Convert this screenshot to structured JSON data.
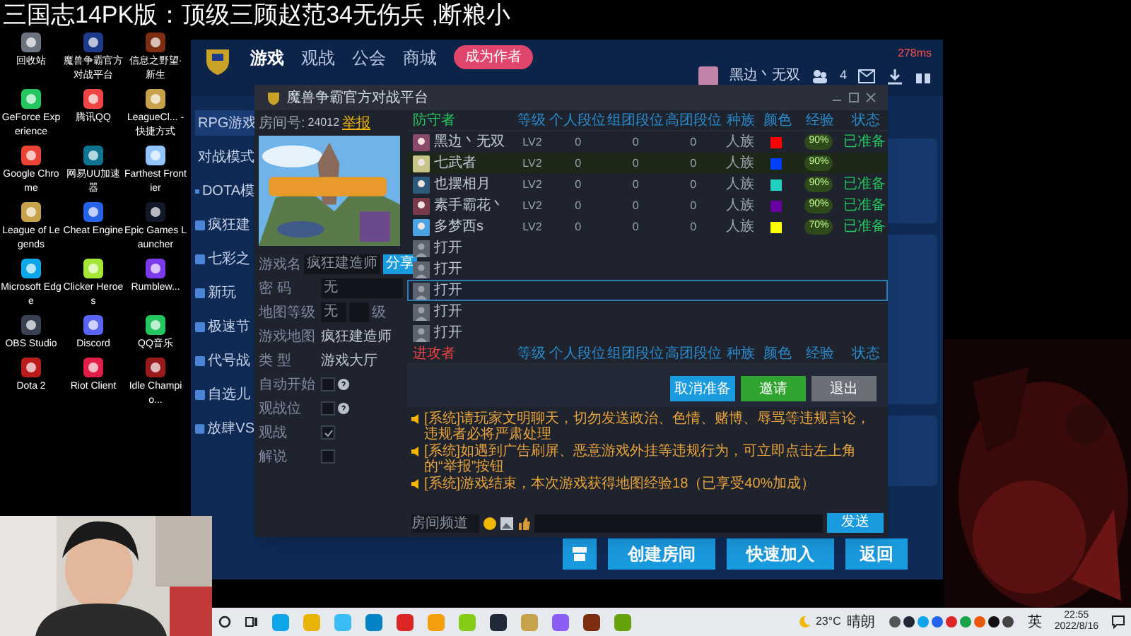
{
  "stream_title": "三国志14PK版：顶级三顾赵范34无伤兵 ,断粮小",
  "desktop_icons": [
    {
      "label": "回收站"
    },
    {
      "label": "魔兽争霸官方对战平台"
    },
    {
      "label": "信息之野望·新生"
    },
    {
      "label": "GeForce Experience"
    },
    {
      "label": "腾讯QQ"
    },
    {
      "label": "LeagueCl... - 快捷方式"
    },
    {
      "label": "Google Chrome"
    },
    {
      "label": "网易UU加速器"
    },
    {
      "label": "Farthest Frontier"
    },
    {
      "label": "League of Legends"
    },
    {
      "label": "Cheat Engine"
    },
    {
      "label": "Epic Games Launcher"
    },
    {
      "label": "Microsoft Edge"
    },
    {
      "label": "Clicker Heroes"
    },
    {
      "label": "Rumblew..."
    },
    {
      "label": "OBS Studio"
    },
    {
      "label": "Discord"
    },
    {
      "label": "QQ音乐"
    },
    {
      "label": "Dota 2"
    },
    {
      "label": "Riot Client"
    },
    {
      "label": "Idle Champio..."
    }
  ],
  "platform": {
    "nav": [
      {
        "label": "游戏",
        "selected": true
      },
      {
        "label": "观战",
        "selected": false
      },
      {
        "label": "公会",
        "selected": false
      },
      {
        "label": "商城",
        "selected": false
      }
    ],
    "author_badge": "成为作者",
    "ping": "278ms",
    "user": "黑边丶无双",
    "notifications": "4",
    "sidebar": [
      {
        "label": "RPG游戏",
        "selected": true
      },
      {
        "label": "对战模式",
        "selected": false
      },
      {
        "label": "DOTA模",
        "selected": false
      },
      {
        "label": "疯狂建",
        "selected": false
      },
      {
        "label": "七彩之",
        "selected": false
      },
      {
        "label": "新玩",
        "selected": false
      },
      {
        "label": "极速节",
        "selected": false
      },
      {
        "label": "代号战",
        "selected": false
      },
      {
        "label": "自选儿",
        "selected": false
      },
      {
        "label": "放肆VS",
        "selected": false
      }
    ],
    "bottom_buttons": [
      "创建房间",
      "快速加入",
      "返回"
    ]
  },
  "dialog": {
    "title": "魔兽争霸官方对战平台",
    "room_label": "房间号:",
    "room_number": "24012",
    "report": "举报",
    "fields": [
      {
        "kind": "input",
        "label": "游戏名",
        "value": "疯狂建造师",
        "button": "分享"
      },
      {
        "kind": "input",
        "label": "密 码",
        "value": "无"
      },
      {
        "kind": "level",
        "label": "地图等级",
        "value": "无",
        "unit": "级"
      },
      {
        "kind": "text",
        "label": "游戏地图",
        "value": "疯狂建造师"
      },
      {
        "kind": "text",
        "label": "类 型",
        "value": "游戏大厅"
      },
      {
        "kind": "check",
        "label": "自动开始",
        "checked": false,
        "help": true
      },
      {
        "kind": "check",
        "label": "观战位",
        "checked": false,
        "help": true
      },
      {
        "kind": "check",
        "label": "观战",
        "checked": true,
        "help": false
      },
      {
        "kind": "check",
        "label": "解说",
        "checked": false,
        "help": false
      }
    ],
    "teams": [
      {
        "label": "防守者",
        "color": "#22c55e",
        "columns": [
          "等级",
          "个人段位",
          "组团段位",
          "高团段位",
          "种族",
          "颜色",
          "经验",
          "状态"
        ],
        "slots": [
          {
            "kind": "player",
            "name": "黑边丶无双",
            "cells": [
              "LV2",
              "0",
              "0",
              "0",
              "人族"
            ],
            "color": "#ff0000",
            "exp": "90%",
            "status": "已准备",
            "is_self": false,
            "selected": false
          },
          {
            "kind": "player",
            "name": "七武者",
            "cells": [
              "LV2",
              "0",
              "0",
              "0",
              "人族"
            ],
            "color": "#0040ff",
            "exp": "90%",
            "is_self": true,
            "selected": false
          },
          {
            "kind": "player",
            "name": "也摆相月",
            "cells": [
              "LV2",
              "0",
              "0",
              "0",
              "人族"
            ],
            "color": "#20d0c0",
            "exp": "90%",
            "status": "已准备",
            "is_self": false,
            "selected": false
          },
          {
            "kind": "player",
            "name": "素手霸花丶",
            "cells": [
              "LV2",
              "0",
              "0",
              "0",
              "人族"
            ],
            "color": "#6a00a0",
            "exp": "90%",
            "status": "已准备",
            "is_self": false,
            "selected": false
          },
          {
            "kind": "player",
            "name": "多梦西s",
            "cells": [
              "LV2",
              "0",
              "0",
              "0",
              "人族"
            ],
            "color": "#ffff00",
            "exp": "70%",
            "status": "已准备",
            "is_self": false,
            "selected": false
          },
          {
            "kind": "open",
            "label": "打开",
            "selected": false
          },
          {
            "kind": "open",
            "label": "打开",
            "selected": false
          },
          {
            "kind": "open",
            "label": "打开",
            "selected": true
          },
          {
            "kind": "open",
            "label": "打开",
            "selected": false
          },
          {
            "kind": "open",
            "label": "打开",
            "selected": false
          }
        ]
      },
      {
        "label": "进攻者",
        "color": "#ef4444",
        "columns": [
          "等级",
          "个人段位",
          "组团段位",
          "高团段位",
          "种族",
          "颜色",
          "经验",
          "状态"
        ]
      }
    ],
    "buttons": [
      {
        "label": "取消准备",
        "kind": "primary",
        "disabled": false
      },
      {
        "label": "邀请",
        "kind": "success",
        "disabled": false
      },
      {
        "label": "退出",
        "disabled": true
      }
    ],
    "messages": [
      "[系统]请玩家文明聊天，切勿发送政治、色情、赌博、辱骂等违规言论，违规者必将严肃处理",
      "[系统]如遇到广告刷屏、恶意游戏外挂等违规行为，可立即点击左上角的“举报”按钮",
      "[系统]游戏结束，本次游戏获得地图经验18（已享受40%加成）"
    ],
    "channel": "房间频道",
    "send": "发送"
  },
  "taskbar": {
    "weather": "23°C",
    "condition": "晴朗",
    "ime": "英",
    "time": "22:55",
    "date": "2022/8/16"
  }
}
